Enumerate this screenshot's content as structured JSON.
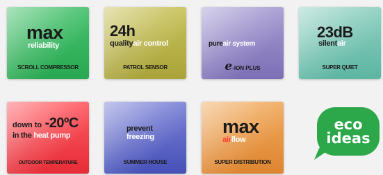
{
  "tiles": [
    {
      "big": "max",
      "sub": "reliability",
      "caption": "SCROLL COMPRESSOR"
    },
    {
      "big": "24h",
      "sub_a": "quality",
      "sub_b": "air control",
      "caption": "PATROL SENSOR"
    },
    {
      "sub_a": "pure",
      "sub_b": "air system",
      "logo_e": "e",
      "logo_text": "-ION PLUS"
    },
    {
      "big": "23dB",
      "sub_a": "silent",
      "sub_b": "air",
      "caption": "SUPER QUIET"
    },
    {
      "line1_a": "down to",
      "line1_b": "-20ºC",
      "line2_a": "in the",
      "line2_b": "heat pump",
      "caption": "OUTDOOR TEMPERATURE"
    },
    {
      "line1": "prevent",
      "line2": "freezing",
      "caption": "SUMMER HOUSE"
    },
    {
      "big": "max",
      "sub_a": "air",
      "sub_b": "flow",
      "caption": "SUPER DISTRIBUTION"
    }
  ],
  "eco_badge": {
    "line1": "eco",
    "line2": "ideas"
  }
}
